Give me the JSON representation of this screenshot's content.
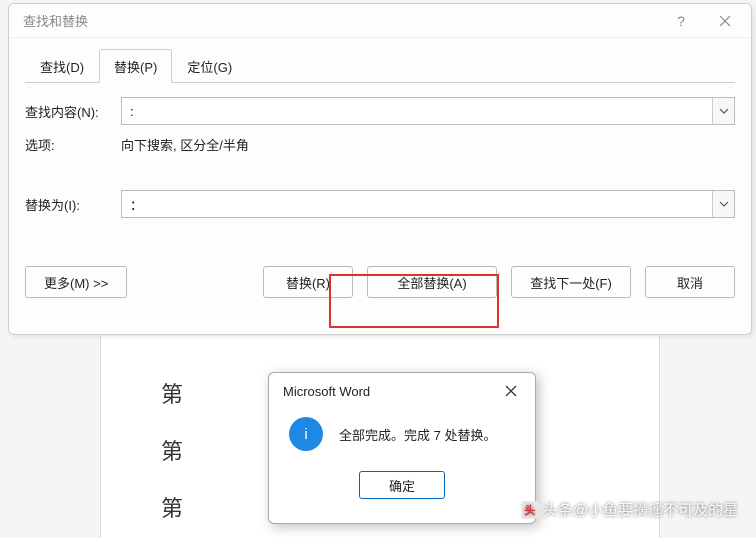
{
  "dialog": {
    "title": "查找和替换",
    "tabs": {
      "find": "查找(D)",
      "replace": "替换(P)",
      "goto": "定位(G)"
    },
    "find_label": "查找内容(N):",
    "find_value": ":",
    "options_label": "选项:",
    "options_value": "向下搜索, 区分全/半角",
    "replace_label": "替换为(I):",
    "replace_value": "：",
    "buttons": {
      "more": "更多(M) >>",
      "replace": "替换(R)",
      "replace_all": "全部替换(A)",
      "find_next": "查找下一处(F)",
      "cancel": "取消"
    }
  },
  "doc": {
    "line1": "第",
    "line2": "第",
    "line3": "第"
  },
  "msgbox": {
    "title": "Microsoft Word",
    "message": "全部完成。完成 7 处替换。",
    "ok": "确定",
    "icon_letter": "i"
  },
  "watermark": {
    "text": "头条@小鱼要摘遥不可及的星"
  }
}
